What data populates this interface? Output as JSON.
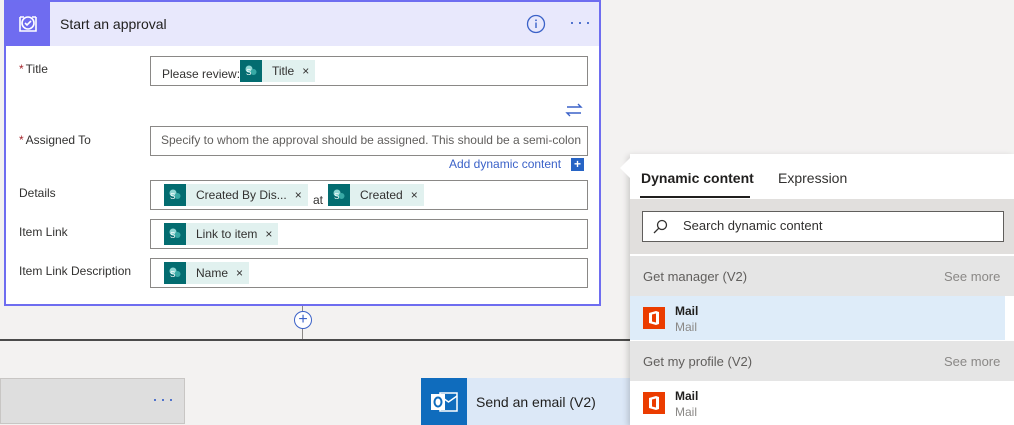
{
  "approval": {
    "title": "Start an approval",
    "fields": {
      "title": {
        "label": "Title",
        "required": "*",
        "prefix_text": "Please review:",
        "tokens": [
          "Title"
        ]
      },
      "assigned_to": {
        "label": "Assigned To",
        "required": "*",
        "placeholder": "Specify to whom the approval should be assigned. This should be a semi-colon"
      },
      "add_dynamic_content": "Add dynamic content",
      "details": {
        "label": "Details",
        "tokens": [
          "Created By Dis...",
          "Created"
        ],
        "between_text": "at"
      },
      "item_link": {
        "label": "Item Link",
        "tokens": [
          "Link to item"
        ]
      },
      "item_link_description": {
        "label": "Item Link Description",
        "tokens": [
          "Name"
        ]
      }
    },
    "token_remove": "×"
  },
  "send_email": {
    "title": "Send an email (V2)"
  },
  "dynamic_panel": {
    "tabs": [
      "Dynamic content",
      "Expression"
    ],
    "active_tab": "Dynamic content",
    "search_placeholder": "Search dynamic content",
    "sections": [
      {
        "title": "Get manager (V2)",
        "see_more": "See more",
        "items": [
          {
            "title": "Mail",
            "subtitle": "Mail"
          }
        ]
      },
      {
        "title": "Get my profile (V2)",
        "see_more": "See more",
        "items": [
          {
            "title": "Mail",
            "subtitle": "Mail"
          }
        ]
      }
    ]
  },
  "colors": {
    "accent": "#6f6cf0",
    "link": "#3b62c8",
    "sharepoint": "#036c70",
    "office": "#eb3c00",
    "outlook": "#0f6cbd"
  },
  "icons": {
    "approval": "approval-check-icon",
    "info": "info-icon",
    "more": "ellipsis-icon",
    "swap": "swap-arrows-icon",
    "sharepoint": "sharepoint-icon",
    "outlook": "outlook-icon",
    "office": "office-icon",
    "search": "search-icon",
    "add": "add-step-icon"
  }
}
